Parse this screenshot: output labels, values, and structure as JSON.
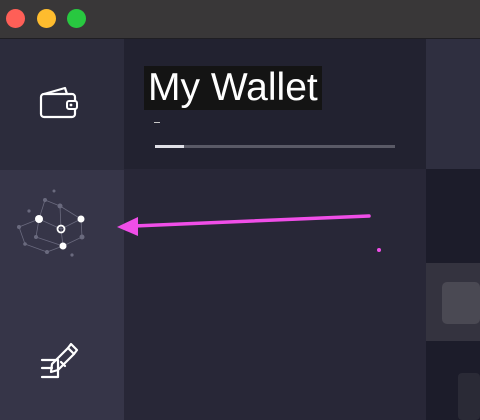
{
  "window": {
    "controls": [
      "close",
      "minimize",
      "zoom"
    ]
  },
  "sidebar": {
    "items": [
      {
        "name": "wallet",
        "icon": "wallet-icon"
      },
      {
        "name": "network",
        "icon": "network-graph-icon"
      },
      {
        "name": "contract",
        "icon": "contract-sign-icon"
      }
    ]
  },
  "header": {
    "title": "My Wallet",
    "subtitle": "-",
    "progress": 0.12
  },
  "annotation": {
    "arrow_color": "#f04ee8",
    "arrow_icon": "pointer-arrow-icon"
  },
  "colors": {
    "accent": "#f04ee8",
    "background": "#262634"
  }
}
